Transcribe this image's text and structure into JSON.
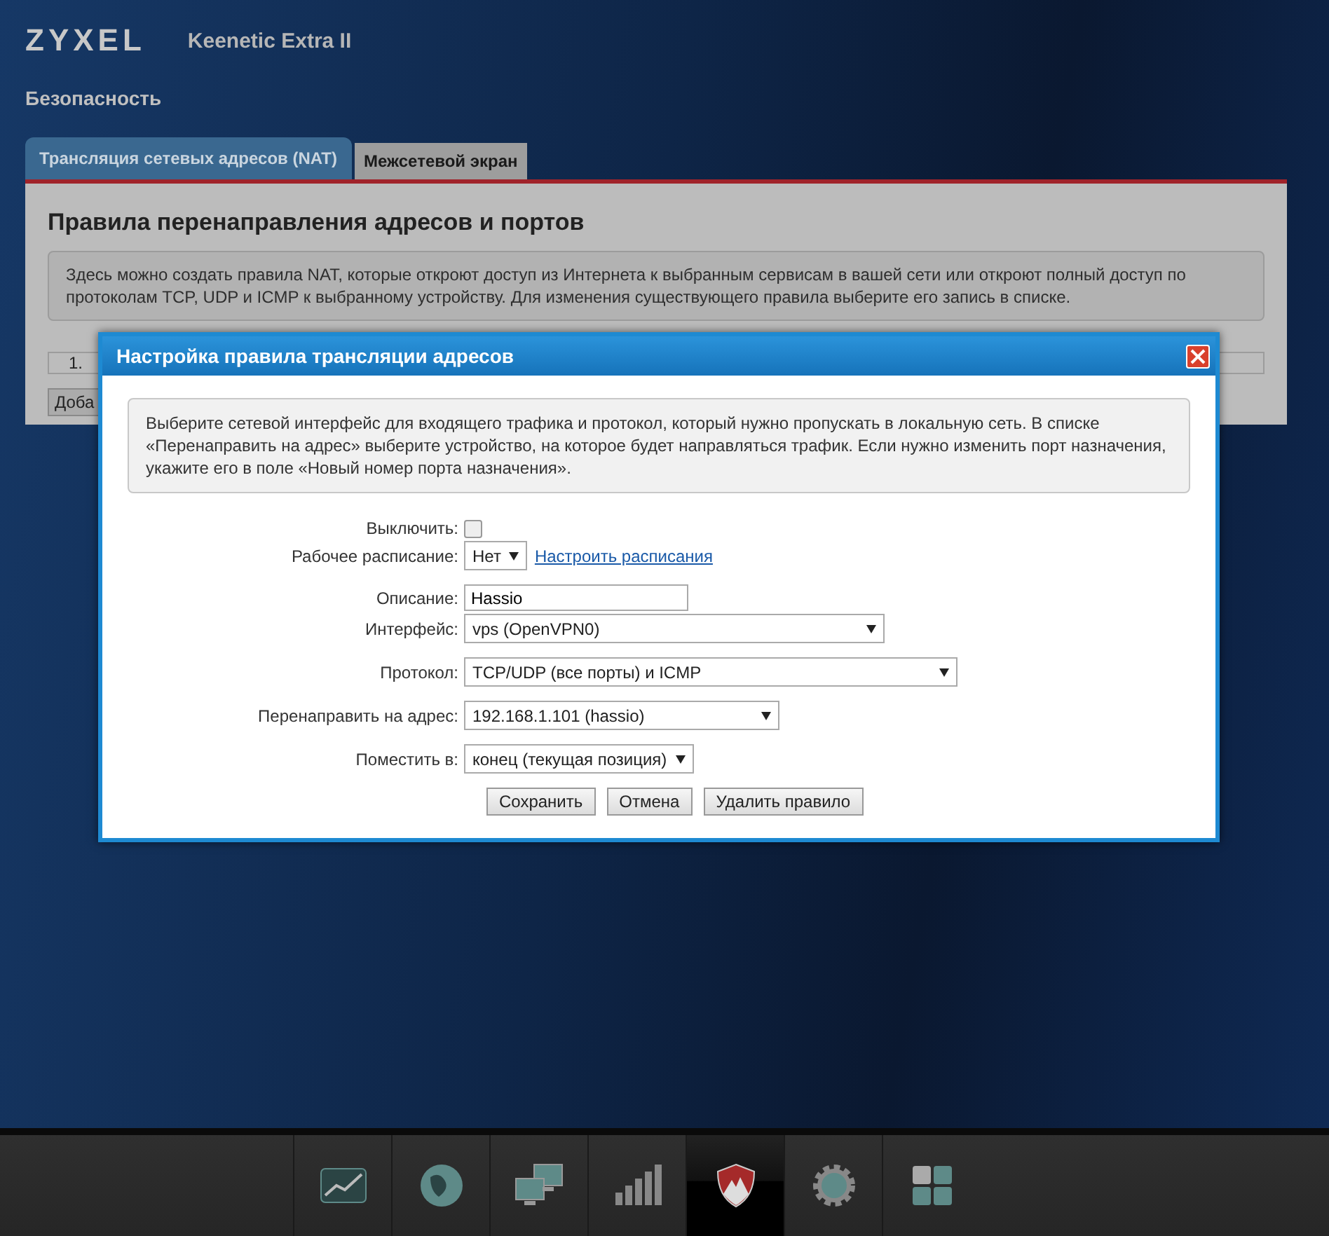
{
  "header": {
    "logo": "ZYXEL",
    "model": "Keenetic Extra II"
  },
  "section_title": "Безопасность",
  "tabs": [
    {
      "label": "Трансляция сетевых адресов (NAT)",
      "selected": true
    },
    {
      "label": "Межсетевой экран",
      "selected": false
    }
  ],
  "panel": {
    "title": "Правила перенаправления адресов и портов",
    "info": "Здесь можно создать правила NAT, которые откроют доступ из Интернета к выбранным сервисам в вашей сети или откроют полный доступ по протоколам TCP, UDP и ICMP к выбранному устройству. Для изменения существующего правила выберите его запись в списке.",
    "row_number": "1.",
    "add_button": "Доба"
  },
  "dialog": {
    "title": "Настройка правила трансляции адресов",
    "info": "Выберите сетевой интерфейс для входящего трафика и протокол, который нужно пропускать в локальную сеть. В списке «Перенаправить на адрес» выберите устройство, на которое будет направляться трафик. Если нужно изменить порт назначения, укажите его в поле «Новый номер порта назначения».",
    "fields": [
      {
        "kind": "checkbox",
        "label": "Выключить:",
        "checked": false
      },
      {
        "kind": "select",
        "label": "Рабочее расписание:",
        "value": "Нет",
        "link": "Настроить расписания"
      },
      {
        "kind": "text",
        "label": "Описание:",
        "value": "Hassio"
      },
      {
        "kind": "select",
        "label": "Интерфейс:",
        "value": "vps (OpenVPN0)"
      },
      {
        "kind": "select",
        "label": "Протокол:",
        "value": "TCP/UDP (все порты) и ICMP"
      },
      {
        "kind": "select",
        "label": "Перенаправить на адрес:",
        "value": "192.168.1.101 (hassio)"
      },
      {
        "kind": "select",
        "label": "Поместить в:",
        "value": "конец (текущая позиция)"
      }
    ],
    "buttons": [
      "Сохранить",
      "Отмена",
      "Удалить правило"
    ]
  },
  "bottom_nav": [
    {
      "kind": "chart",
      "selected": false
    },
    {
      "kind": "globe",
      "selected": false
    },
    {
      "kind": "computers",
      "selected": false
    },
    {
      "kind": "signal",
      "selected": false
    },
    {
      "kind": "shield",
      "selected": true
    },
    {
      "kind": "gear",
      "selected": false
    },
    {
      "kind": "grid",
      "selected": false
    }
  ]
}
